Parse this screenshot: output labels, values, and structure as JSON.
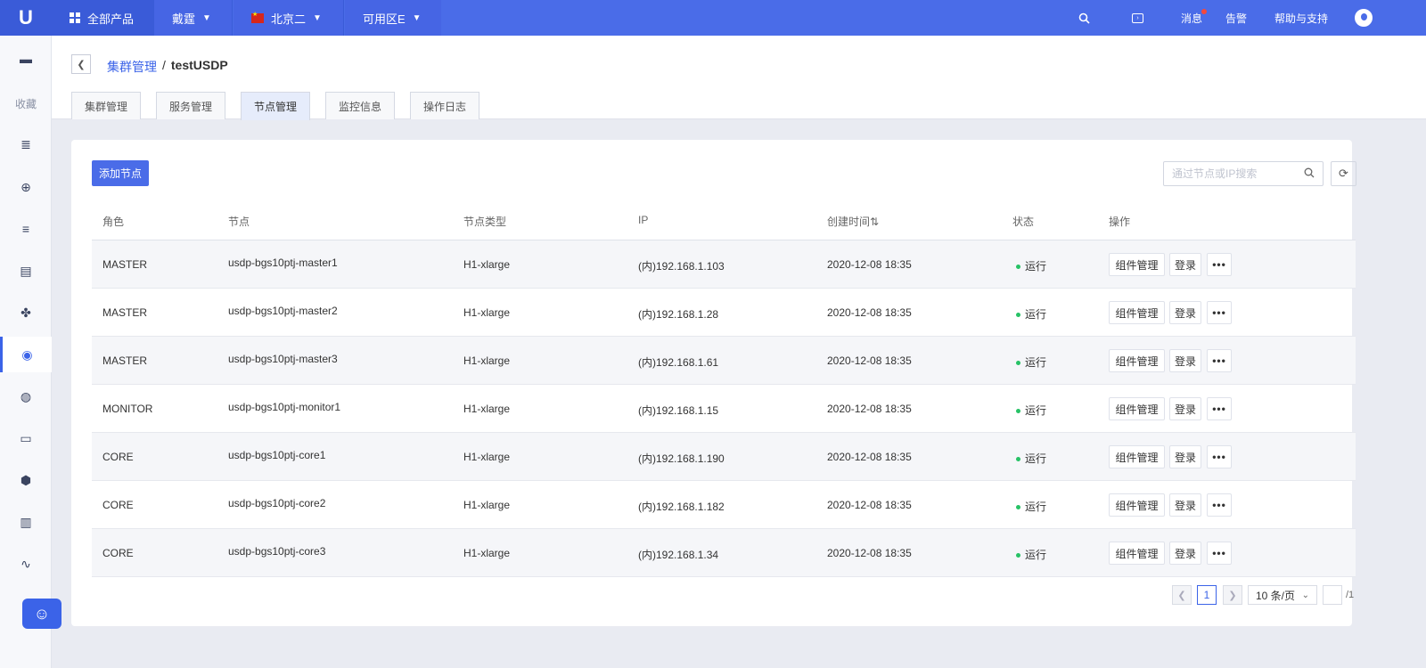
{
  "topbar": {
    "logo": "U",
    "all_products": "全部产品",
    "project": "戴霆",
    "region": "北京二",
    "zone": "可用区E",
    "messages": "消息",
    "alerts": "告警",
    "help": "帮助与支持"
  },
  "sidebar": {
    "favorites_label": "收藏"
  },
  "breadcrumb": {
    "parent": "集群管理",
    "separator": "/",
    "current": "testUSDP"
  },
  "tabs": [
    {
      "label": "集群管理"
    },
    {
      "label": "服务管理"
    },
    {
      "label": "节点管理"
    },
    {
      "label": "监控信息"
    },
    {
      "label": "操作日志"
    }
  ],
  "toolbar": {
    "add_node": "添加节点",
    "search_placeholder": "通过节点或IP搜索"
  },
  "table": {
    "columns": [
      "角色",
      "节点",
      "节点类型",
      "IP",
      "创建时间⇅",
      "状态",
      "操作"
    ],
    "rows": [
      {
        "role": "MASTER",
        "node": "usdp-bgs10ptj-master1",
        "type": "H1-xlarge",
        "ip": "(内)192.168.1.103",
        "created": "2020-12-08 18:35",
        "status": "运行"
      },
      {
        "role": "MASTER",
        "node": "usdp-bgs10ptj-master2",
        "type": "H1-xlarge",
        "ip": "(内)192.168.1.28",
        "created": "2020-12-08 18:35",
        "status": "运行"
      },
      {
        "role": "MASTER",
        "node": "usdp-bgs10ptj-master3",
        "type": "H1-xlarge",
        "ip": "(内)192.168.1.61",
        "created": "2020-12-08 18:35",
        "status": "运行"
      },
      {
        "role": "MONITOR",
        "node": "usdp-bgs10ptj-monitor1",
        "type": "H1-xlarge",
        "ip": "(内)192.168.1.15",
        "created": "2020-12-08 18:35",
        "status": "运行"
      },
      {
        "role": "CORE",
        "node": "usdp-bgs10ptj-core1",
        "type": "H1-xlarge",
        "ip": "(内)192.168.1.190",
        "created": "2020-12-08 18:35",
        "status": "运行"
      },
      {
        "role": "CORE",
        "node": "usdp-bgs10ptj-core2",
        "type": "H1-xlarge",
        "ip": "(内)192.168.1.182",
        "created": "2020-12-08 18:35",
        "status": "运行"
      },
      {
        "role": "CORE",
        "node": "usdp-bgs10ptj-core3",
        "type": "H1-xlarge",
        "ip": "(内)192.168.1.34",
        "created": "2020-12-08 18:35",
        "status": "运行"
      }
    ],
    "actions": {
      "manage": "组件管理",
      "login": "登录",
      "more": "•••"
    }
  },
  "pagination": {
    "current_page": "1",
    "page_size": "10 条/页",
    "total": "/1"
  },
  "colors": {
    "primary": "#4a6ce8",
    "status_running": "#27c266"
  }
}
